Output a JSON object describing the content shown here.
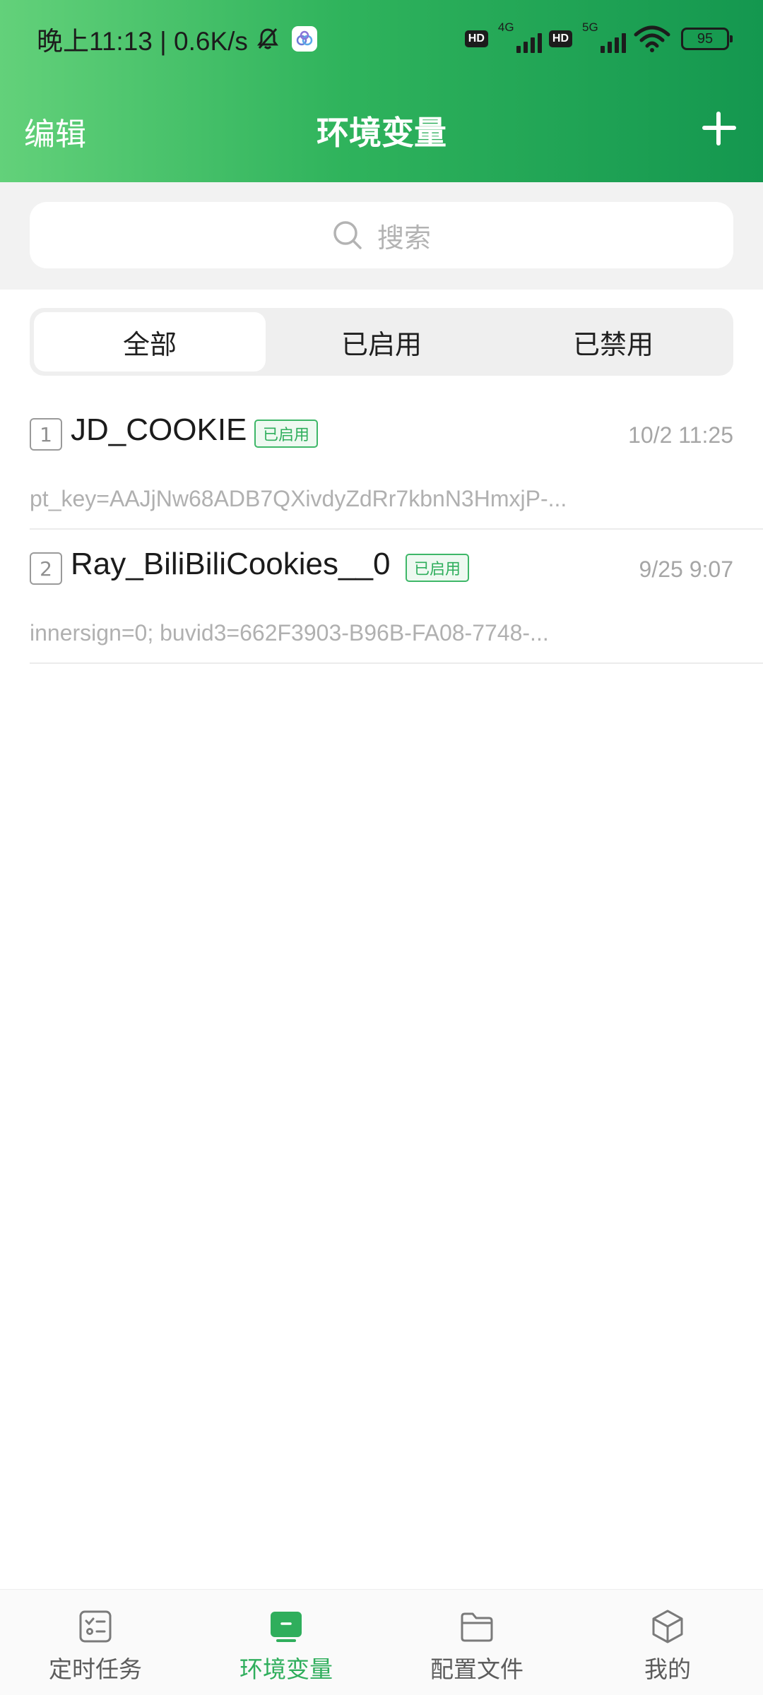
{
  "status_bar": {
    "time_text": "晚上11:13 | 0.6K/s",
    "hd_label": "HD",
    "net1": "4G",
    "net2": "5G",
    "battery": "95"
  },
  "nav": {
    "edit_label": "编辑",
    "title": "环境变量"
  },
  "search": {
    "placeholder": "搜索"
  },
  "segments": [
    {
      "label": "全部",
      "active": true
    },
    {
      "label": "已启用",
      "active": false
    },
    {
      "label": "已禁用",
      "active": false
    }
  ],
  "env_list": [
    {
      "index": "1",
      "name": "JD_COOKIE",
      "status": "已启用",
      "date": "10/2 11:25",
      "value": "pt_key=AAJjNw68ADB7QXivdyZdRr7kbnN3HmxjP-..."
    },
    {
      "index": "2",
      "name": "Ray_BiliBiliCookies__0",
      "status": "已启用",
      "date": "9/25 9:07",
      "value": "innersign=0; buvid3=662F3903-B96B-FA08-7748-..."
    }
  ],
  "tabs": [
    {
      "label": "定时任务",
      "icon": "task-icon",
      "active": false
    },
    {
      "label": "环境变量",
      "icon": "env-icon",
      "active": true
    },
    {
      "label": "配置文件",
      "icon": "folder-icon",
      "active": false
    },
    {
      "label": "我的",
      "icon": "cube-icon",
      "active": false
    }
  ],
  "colors": {
    "accent": "#2fae5c",
    "header_start": "#63d17a",
    "header_end": "#14974f"
  }
}
